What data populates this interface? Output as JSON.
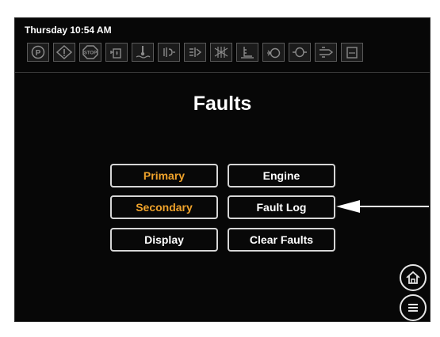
{
  "status": {
    "datetime": "Thursday 10:54 AM"
  },
  "indicators": [
    "park-brake-icon",
    "warning-icon",
    "stop-icon",
    "fuel-icon",
    "coolant-temp-icon",
    "glow-plug-icon",
    "intake-heater-icon",
    "air-filter-icon",
    "oil-level-icon",
    "oil-pressure-icon",
    "battery-icon",
    "water-in-fuel-icon",
    "def-tank-icon"
  ],
  "labels": {
    "stop": "STOP",
    "park": "P"
  },
  "page": {
    "title": "Faults"
  },
  "menu": {
    "primary": "Primary",
    "engine": "Engine",
    "secondary": "Secondary",
    "fault_log": "Fault Log",
    "display": "Display",
    "clear_faults": "Clear Faults"
  },
  "colors": {
    "accent": "#f0a32b",
    "text": "#ffffff",
    "background": "#070707"
  }
}
